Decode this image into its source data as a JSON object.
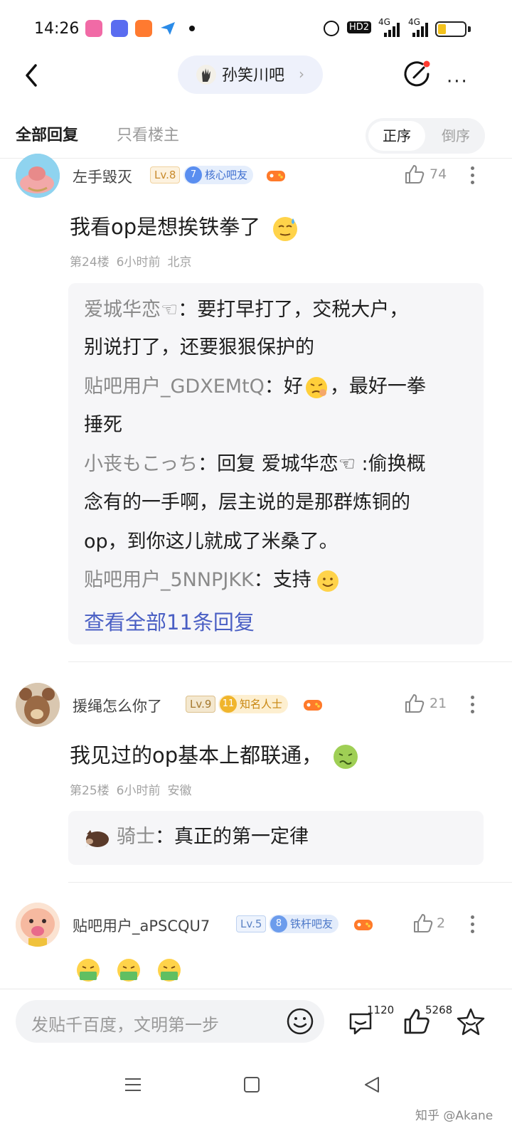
{
  "status_bar": {
    "time": "14:26",
    "hd": "HD2",
    "signal1": "4G",
    "signal2": "4G",
    "battery_level": 0.3
  },
  "nav": {
    "forum_name": "孙笑川吧"
  },
  "tabs": {
    "all": "全部回复",
    "op_only": "只看楼主",
    "sort_asc": "正序",
    "sort_desc": "倒序"
  },
  "posts": [
    {
      "username": "左手毁灭",
      "level": "Lv.8",
      "tag_num": "7",
      "tag_label": "核心吧友",
      "likes": "74",
      "text": "我看op是想挨铁拳了",
      "floor": "第24楼",
      "time": "6小时前",
      "location": "北京",
      "replies": [
        {
          "name": "爱城华恋☜",
          "text_1": "要打早打了，交税大户，",
          "text_2": "别说打了，还要狠狠保护的"
        },
        {
          "name": "贴吧用户_GDXEMtQ",
          "text_1": "好",
          "text_2": "，最好一拳",
          "text_3": "捶死"
        },
        {
          "name": "小丧もこっち",
          "text_1": "回复 爱城华恋☜ :偷换概",
          "text_2": "念有的一手啊，层主说的是那群炼铜的",
          "text_3": "op，到你这儿就成了米桑了。"
        },
        {
          "name": "贴吧用户_5NNPJKK",
          "text_1": "支持"
        }
      ],
      "view_all": "查看全部11条回复"
    },
    {
      "username": "援绳怎么你了",
      "level": "Lv.9",
      "tag_num": "11",
      "tag_label": "知名人士",
      "likes": "21",
      "text": "我见过的op基本上都联通，",
      "floor": "第25楼",
      "time": "6小时前",
      "location": "安徽",
      "replies": [
        {
          "name": "骑士",
          "text_1": "真正的第一定律"
        }
      ]
    },
    {
      "username": "贴吧用户_aPSCQU7",
      "level": "Lv.5",
      "tag_num": "8",
      "tag_label": "铁杆吧友",
      "likes": "2"
    }
  ],
  "bottom": {
    "input_placeholder": "发贴千百度，文明第一步",
    "comment_count": "1120",
    "like_count": "5268"
  },
  "watermark": "知乎 @Akane",
  "icons": [
    "back-icon",
    "forum-avatar-icon",
    "edit-icon",
    "more-icon",
    "thumb-up-icon",
    "more-vertical-icon",
    "game-controller-icon",
    "smiley-icon",
    "comment-icon",
    "star-icon",
    "menu-icon",
    "home-icon",
    "back-triangle-icon"
  ],
  "colors": {
    "link": "#4a5fc4",
    "accent_orange": "#ff8a3a",
    "tag_blue": "#5a8ef0",
    "tag_gold": "#f0b52c"
  }
}
